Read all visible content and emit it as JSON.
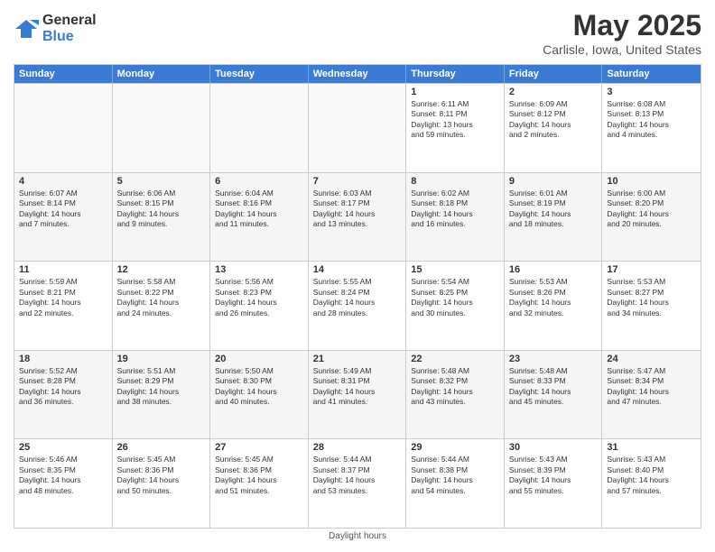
{
  "logo": {
    "general": "General",
    "blue": "Blue"
  },
  "title": "May 2025",
  "subtitle": "Carlisle, Iowa, United States",
  "footer": "Daylight hours",
  "headers": [
    "Sunday",
    "Monday",
    "Tuesday",
    "Wednesday",
    "Thursday",
    "Friday",
    "Saturday"
  ],
  "weeks": [
    [
      {
        "day": "",
        "lines": []
      },
      {
        "day": "",
        "lines": []
      },
      {
        "day": "",
        "lines": []
      },
      {
        "day": "",
        "lines": []
      },
      {
        "day": "1",
        "lines": [
          "Sunrise: 6:11 AM",
          "Sunset: 8:11 PM",
          "Daylight: 13 hours",
          "and 59 minutes."
        ]
      },
      {
        "day": "2",
        "lines": [
          "Sunrise: 6:09 AM",
          "Sunset: 8:12 PM",
          "Daylight: 14 hours",
          "and 2 minutes."
        ]
      },
      {
        "day": "3",
        "lines": [
          "Sunrise: 6:08 AM",
          "Sunset: 8:13 PM",
          "Daylight: 14 hours",
          "and 4 minutes."
        ]
      }
    ],
    [
      {
        "day": "4",
        "lines": [
          "Sunrise: 6:07 AM",
          "Sunset: 8:14 PM",
          "Daylight: 14 hours",
          "and 7 minutes."
        ]
      },
      {
        "day": "5",
        "lines": [
          "Sunrise: 6:06 AM",
          "Sunset: 8:15 PM",
          "Daylight: 14 hours",
          "and 9 minutes."
        ]
      },
      {
        "day": "6",
        "lines": [
          "Sunrise: 6:04 AM",
          "Sunset: 8:16 PM",
          "Daylight: 14 hours",
          "and 11 minutes."
        ]
      },
      {
        "day": "7",
        "lines": [
          "Sunrise: 6:03 AM",
          "Sunset: 8:17 PM",
          "Daylight: 14 hours",
          "and 13 minutes."
        ]
      },
      {
        "day": "8",
        "lines": [
          "Sunrise: 6:02 AM",
          "Sunset: 8:18 PM",
          "Daylight: 14 hours",
          "and 16 minutes."
        ]
      },
      {
        "day": "9",
        "lines": [
          "Sunrise: 6:01 AM",
          "Sunset: 8:19 PM",
          "Daylight: 14 hours",
          "and 18 minutes."
        ]
      },
      {
        "day": "10",
        "lines": [
          "Sunrise: 6:00 AM",
          "Sunset: 8:20 PM",
          "Daylight: 14 hours",
          "and 20 minutes."
        ]
      }
    ],
    [
      {
        "day": "11",
        "lines": [
          "Sunrise: 5:59 AM",
          "Sunset: 8:21 PM",
          "Daylight: 14 hours",
          "and 22 minutes."
        ]
      },
      {
        "day": "12",
        "lines": [
          "Sunrise: 5:58 AM",
          "Sunset: 8:22 PM",
          "Daylight: 14 hours",
          "and 24 minutes."
        ]
      },
      {
        "day": "13",
        "lines": [
          "Sunrise: 5:56 AM",
          "Sunset: 8:23 PM",
          "Daylight: 14 hours",
          "and 26 minutes."
        ]
      },
      {
        "day": "14",
        "lines": [
          "Sunrise: 5:55 AM",
          "Sunset: 8:24 PM",
          "Daylight: 14 hours",
          "and 28 minutes."
        ]
      },
      {
        "day": "15",
        "lines": [
          "Sunrise: 5:54 AM",
          "Sunset: 8:25 PM",
          "Daylight: 14 hours",
          "and 30 minutes."
        ]
      },
      {
        "day": "16",
        "lines": [
          "Sunrise: 5:53 AM",
          "Sunset: 8:26 PM",
          "Daylight: 14 hours",
          "and 32 minutes."
        ]
      },
      {
        "day": "17",
        "lines": [
          "Sunrise: 5:53 AM",
          "Sunset: 8:27 PM",
          "Daylight: 14 hours",
          "and 34 minutes."
        ]
      }
    ],
    [
      {
        "day": "18",
        "lines": [
          "Sunrise: 5:52 AM",
          "Sunset: 8:28 PM",
          "Daylight: 14 hours",
          "and 36 minutes."
        ]
      },
      {
        "day": "19",
        "lines": [
          "Sunrise: 5:51 AM",
          "Sunset: 8:29 PM",
          "Daylight: 14 hours",
          "and 38 minutes."
        ]
      },
      {
        "day": "20",
        "lines": [
          "Sunrise: 5:50 AM",
          "Sunset: 8:30 PM",
          "Daylight: 14 hours",
          "and 40 minutes."
        ]
      },
      {
        "day": "21",
        "lines": [
          "Sunrise: 5:49 AM",
          "Sunset: 8:31 PM",
          "Daylight: 14 hours",
          "and 41 minutes."
        ]
      },
      {
        "day": "22",
        "lines": [
          "Sunrise: 5:48 AM",
          "Sunset: 8:32 PM",
          "Daylight: 14 hours",
          "and 43 minutes."
        ]
      },
      {
        "day": "23",
        "lines": [
          "Sunrise: 5:48 AM",
          "Sunset: 8:33 PM",
          "Daylight: 14 hours",
          "and 45 minutes."
        ]
      },
      {
        "day": "24",
        "lines": [
          "Sunrise: 5:47 AM",
          "Sunset: 8:34 PM",
          "Daylight: 14 hours",
          "and 47 minutes."
        ]
      }
    ],
    [
      {
        "day": "25",
        "lines": [
          "Sunrise: 5:46 AM",
          "Sunset: 8:35 PM",
          "Daylight: 14 hours",
          "and 48 minutes."
        ]
      },
      {
        "day": "26",
        "lines": [
          "Sunrise: 5:45 AM",
          "Sunset: 8:36 PM",
          "Daylight: 14 hours",
          "and 50 minutes."
        ]
      },
      {
        "day": "27",
        "lines": [
          "Sunrise: 5:45 AM",
          "Sunset: 8:36 PM",
          "Daylight: 14 hours",
          "and 51 minutes."
        ]
      },
      {
        "day": "28",
        "lines": [
          "Sunrise: 5:44 AM",
          "Sunset: 8:37 PM",
          "Daylight: 14 hours",
          "and 53 minutes."
        ]
      },
      {
        "day": "29",
        "lines": [
          "Sunrise: 5:44 AM",
          "Sunset: 8:38 PM",
          "Daylight: 14 hours",
          "and 54 minutes."
        ]
      },
      {
        "day": "30",
        "lines": [
          "Sunrise: 5:43 AM",
          "Sunset: 8:39 PM",
          "Daylight: 14 hours",
          "and 55 minutes."
        ]
      },
      {
        "day": "31",
        "lines": [
          "Sunrise: 5:43 AM",
          "Sunset: 8:40 PM",
          "Daylight: 14 hours",
          "and 57 minutes."
        ]
      }
    ]
  ]
}
